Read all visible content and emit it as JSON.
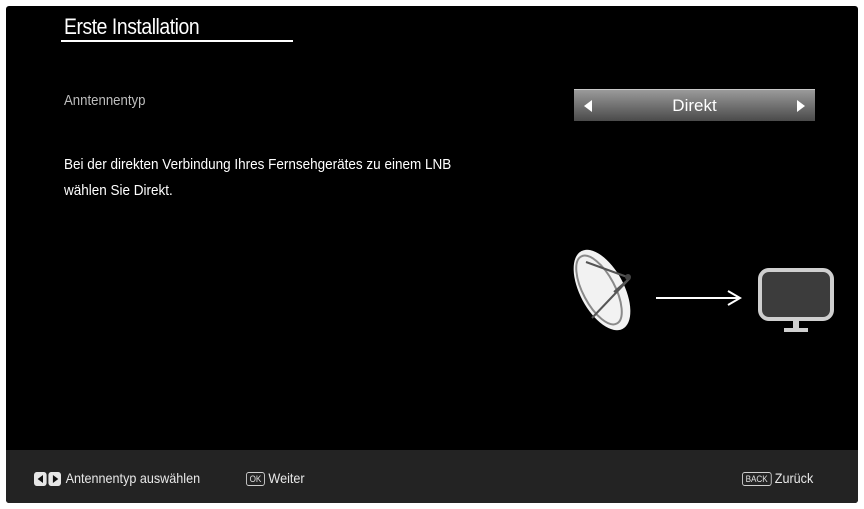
{
  "header": {
    "title": "Erste Installation"
  },
  "setting": {
    "label": "Anntennentyp",
    "value": "Direkt"
  },
  "description": {
    "line1": "Bei der direkten Verbindung Ihres Fernsehgerätes zu einem LNB",
    "line2": "wählen Sie Direkt."
  },
  "footer": {
    "select_hint": "Antennentyp auswählen",
    "ok_key": "OK",
    "ok_label": "Weiter",
    "back_key": "BACK",
    "back_label": "Zurück"
  },
  "icons": {
    "dish": "satellite-dish-icon",
    "arrow": "arrow-right-icon",
    "tv": "tv-icon",
    "left_key": "left-arrow-key-icon",
    "right_key": "right-arrow-key-icon"
  },
  "colors": {
    "background": "#000000",
    "footer": "#232323",
    "selector_top": "#9a9a9a",
    "selector_bottom": "#4a4a4a",
    "label": "#bdbdbd"
  }
}
